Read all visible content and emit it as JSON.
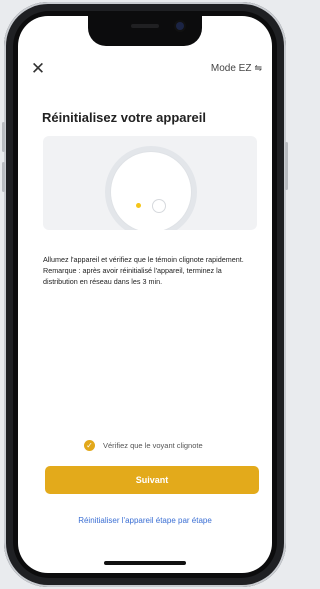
{
  "header": {
    "close_icon": "close-icon",
    "mode_label": "Mode EZ",
    "mode_icon": "wifi-icon"
  },
  "main": {
    "title": "Réinitialisez votre appareil",
    "description_line1": "Allumez l'appareil et vérifiez que le témoin clignote rapidement.",
    "description_line2": "Remarque : après avoir réinitialisé l'appareil, terminez la distribution en réseau dans les 3 min."
  },
  "confirm": {
    "label": "Vérifiez que le voyant clignote",
    "checked": true,
    "icon": "check-icon"
  },
  "buttons": {
    "next_label": "Suivant",
    "reset_link": "Réinitialiser l'appareil étape par étape"
  },
  "colors": {
    "accent": "#e3aa1b",
    "link": "#3b6fd4",
    "led": "#f5c518"
  }
}
